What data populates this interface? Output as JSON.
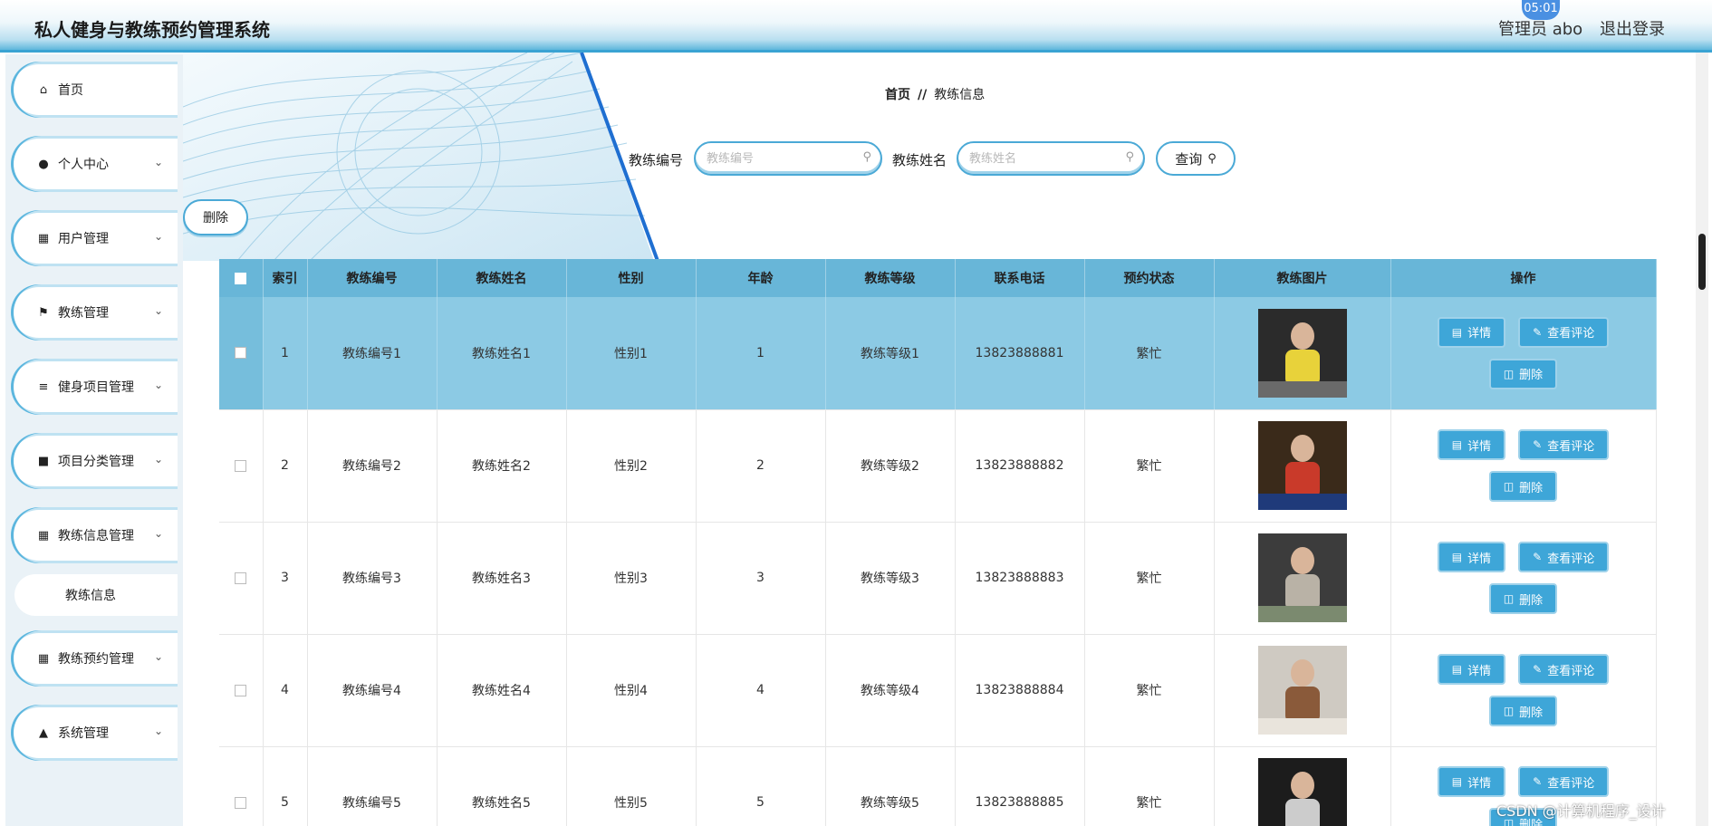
{
  "header": {
    "app_title": "私人健身与教练预约管理系统",
    "user_label": "管理员 abo",
    "logout": "退出登录",
    "timer": "05:01"
  },
  "sidebar": {
    "items": [
      {
        "label": "首页",
        "icon": "home-icon"
      },
      {
        "label": "个人中心",
        "icon": "person-icon"
      },
      {
        "label": "用户管理",
        "icon": "grid-icon"
      },
      {
        "label": "教练管理",
        "icon": "flag-icon"
      },
      {
        "label": "健身项目管理",
        "icon": "sliders-icon"
      },
      {
        "label": "项目分类管理",
        "icon": "box-icon"
      },
      {
        "label": "教练信息管理",
        "icon": "grid-icon"
      },
      {
        "label": "教练预约管理",
        "icon": "grid-icon"
      },
      {
        "label": "系统管理",
        "icon": "user-icon"
      }
    ],
    "sub_item": "教练信息"
  },
  "breadcrumb": {
    "home": "首页",
    "sep": "//",
    "current": "教练信息"
  },
  "search": {
    "coach_no_label": "教练编号",
    "coach_no_placeholder": "教练编号",
    "coach_name_label": "教练姓名",
    "coach_name_placeholder": "教练姓名",
    "query_button": "查询"
  },
  "toolbar": {
    "delete_label": "删除"
  },
  "table": {
    "headers": [
      "索引",
      "教练编号",
      "教练姓名",
      "性别",
      "年龄",
      "教练等级",
      "联系电话",
      "预约状态",
      "教练图片",
      "操作"
    ],
    "rows": [
      {
        "index": "1",
        "no": "教练编号1",
        "name": "教练姓名1",
        "gender": "性别1",
        "age": "1",
        "level": "教练等级1",
        "phone": "13823888881",
        "status": "繁忙"
      },
      {
        "index": "2",
        "no": "教练编号2",
        "name": "教练姓名2",
        "gender": "性别2",
        "age": "2",
        "level": "教练等级2",
        "phone": "13823888882",
        "status": "繁忙"
      },
      {
        "index": "3",
        "no": "教练编号3",
        "name": "教练姓名3",
        "gender": "性别3",
        "age": "3",
        "level": "教练等级3",
        "phone": "13823888883",
        "status": "繁忙"
      },
      {
        "index": "4",
        "no": "教练编号4",
        "name": "教练姓名4",
        "gender": "性别4",
        "age": "4",
        "level": "教练等级4",
        "phone": "13823888884",
        "status": "繁忙"
      },
      {
        "index": "5",
        "no": "教练编号5",
        "name": "教练姓名5",
        "gender": "性别5",
        "age": "5",
        "level": "教练等级5",
        "phone": "13823888885",
        "status": "繁忙"
      }
    ],
    "actions": {
      "detail": "详情",
      "comments": "查看评论",
      "delete": "删除"
    }
  },
  "watermark": "CSDN @计算机程序_设计",
  "colors": {
    "accent": "#3ea6d8",
    "header_row": "#68b6d8",
    "highlight_row": "#8ccae4"
  }
}
